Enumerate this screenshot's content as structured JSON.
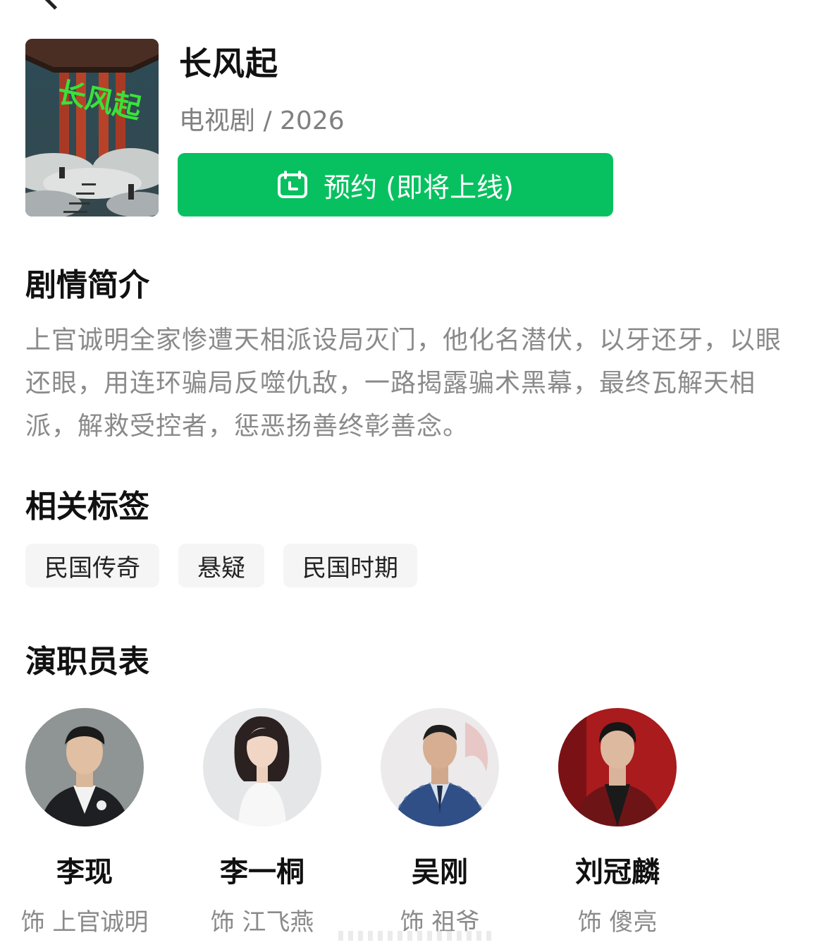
{
  "nav": {
    "back_icon": "chevron-left-icon"
  },
  "show": {
    "title": "长风起",
    "meta": "电视剧 / 2026",
    "poster_calligraphy": "长风起"
  },
  "reserve": {
    "label": "预约 (即将上线)",
    "icon": "calendar-icon",
    "color": "#07c160"
  },
  "synopsis": {
    "heading": "剧情简介",
    "text": "上官诚明全家惨遭天相派设局灭门，他化名潜伏，以牙还牙，以眼还眼，用连环骗局反噬仇敌，一路揭露骗术黑幕，最终瓦解天相派，解救受控者，惩恶扬善终彰善念。"
  },
  "tags": {
    "heading": "相关标签",
    "items": [
      "民国传奇",
      "悬疑",
      "民国时期"
    ]
  },
  "cast": {
    "heading": "演职员表",
    "members": [
      {
        "name": "李现",
        "role": "饰 上官诚明"
      },
      {
        "name": "李一桐",
        "role": "饰 江飞燕"
      },
      {
        "name": "吴刚",
        "role": "饰 祖爷"
      },
      {
        "name": "刘冠麟",
        "role": "饰 傻亮"
      }
    ]
  }
}
